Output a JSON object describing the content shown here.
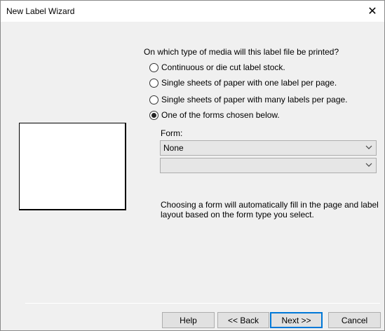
{
  "window": {
    "title": "New Label Wizard",
    "close_glyph": "✕"
  },
  "question": "On which type of media will this label file be printed?",
  "options": [
    {
      "label": "Continuous or die cut label stock.",
      "selected": false
    },
    {
      "label": "Single sheets of paper with one label per page.",
      "selected": false
    },
    {
      "label": "Single sheets of paper with many labels per page.",
      "selected": false
    },
    {
      "label": "One of the forms chosen below.",
      "selected": true
    }
  ],
  "form": {
    "label": "Form:",
    "value": "None",
    "second_value": ""
  },
  "info": "Choosing a form will automatically fill in the page and label layout based on the form type you select.",
  "buttons": {
    "help": "Help",
    "back": "<< Back",
    "next": "Next >>",
    "cancel": "Cancel"
  },
  "icons": {
    "close": "close-icon",
    "dropdown": "chevron-down-icon"
  }
}
